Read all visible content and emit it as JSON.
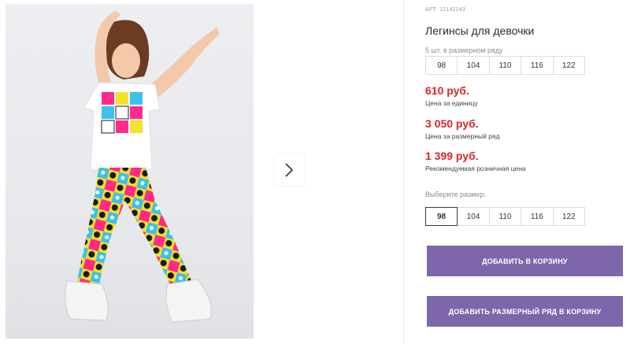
{
  "product": {
    "sku": "АРТ: 12142143",
    "title": "Легинсы для девочки",
    "pack_label": "5 шт. в размерном ряду",
    "pack_sizes": [
      "98",
      "104",
      "110",
      "116",
      "122"
    ],
    "price_unit": "610 руб.",
    "price_unit_caption": "Цена за единицу",
    "price_pack": "3 050 руб.",
    "price_pack_caption": "Цена за размерный ряд",
    "price_rrp": "1 399 руб.",
    "price_rrp_caption": "Рекомендуемая розничная цена",
    "choose_label": "Выберите размер:",
    "choose_sizes": [
      "98",
      "104",
      "110",
      "116",
      "122"
    ],
    "selected_size": "98"
  },
  "actions": {
    "add_to_cart": "ДОБАВИТЬ В КОРЗИНУ",
    "add_pack_to_cart": "ДОБАВИТЬ РАЗМЕРНЫЙ РЯД В КОРЗИНУ"
  },
  "icons": {
    "next": "chevron-right-icon"
  },
  "colors": {
    "price": "#d7262b",
    "button": "#7e66aa"
  }
}
